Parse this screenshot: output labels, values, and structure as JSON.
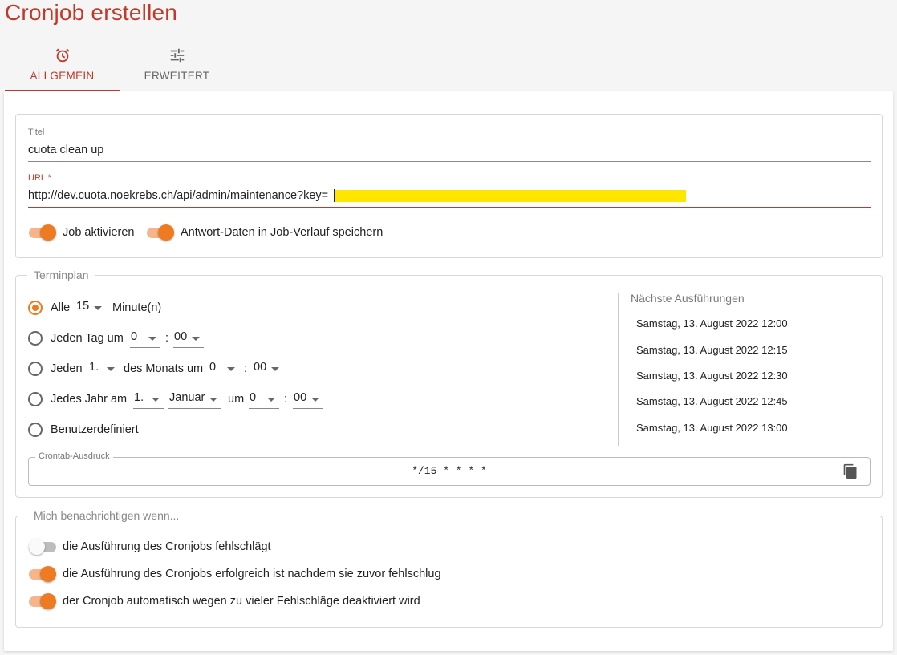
{
  "page": {
    "title": "Cronjob erstellen"
  },
  "tabs": [
    {
      "label": "ALLGEMEIN",
      "icon": "alarm-clock-icon",
      "active": true
    },
    {
      "label": "ERWEITERT",
      "icon": "sliders-icon",
      "active": false
    }
  ],
  "general": {
    "title_label": "Titel",
    "title_value": "cuota clean up",
    "url_label": "URL *",
    "url_value": "http://dev.cuota.noekrebs.ch/api/admin/maintenance?key=",
    "toggles": [
      {
        "label": "Job aktivieren",
        "on": true
      },
      {
        "label": "Antwort-Daten in Job-Verlauf speichern",
        "on": true
      }
    ]
  },
  "schedule": {
    "legend": "Terminplan",
    "every": {
      "label": "Alle",
      "value": "15",
      "unit": "Minute(n)",
      "checked": true
    },
    "daily": {
      "label": "Jeden Tag um",
      "hour": "0",
      "sep": ":",
      "minute": "00",
      "checked": false
    },
    "monthly": {
      "label": "Jeden",
      "day": "1.",
      "mid": "des Monats um",
      "hour": "0",
      "sep": ":",
      "minute": "00",
      "checked": false
    },
    "yearly": {
      "label": "Jedes Jahr am",
      "day": "1.",
      "month": "Januar",
      "mid": "um",
      "hour": "0",
      "sep": ":",
      "minute": "00",
      "checked": false
    },
    "custom": {
      "label": "Benutzerdefiniert",
      "checked": false
    },
    "next_title": "Nächste Ausführungen",
    "next_runs": [
      "Samstag, 13. August 2022 12:00",
      "Samstag, 13. August 2022 12:15",
      "Samstag, 13. August 2022 12:30",
      "Samstag, 13. August 2022 12:45",
      "Samstag, 13. August 2022 13:00"
    ],
    "crontab_label": "Crontab-Ausdruck",
    "crontab_value": "*/15 * * * *"
  },
  "notify": {
    "legend": "Mich benachrichtigen wenn...",
    "items": [
      {
        "label": "die Ausführung des Cronjobs fehlschlägt",
        "on": false
      },
      {
        "label": "die Ausführung des Cronjobs erfolgreich ist nachdem sie zuvor fehlschlug",
        "on": true
      },
      {
        "label": "der Cronjob automatisch wegen zu vieler Fehlschläge deaktiviert wird",
        "on": true
      }
    ]
  },
  "colors": {
    "accent": "#c0392b",
    "toggle_on": "#ee7b22",
    "highlight": "#ffe600"
  }
}
